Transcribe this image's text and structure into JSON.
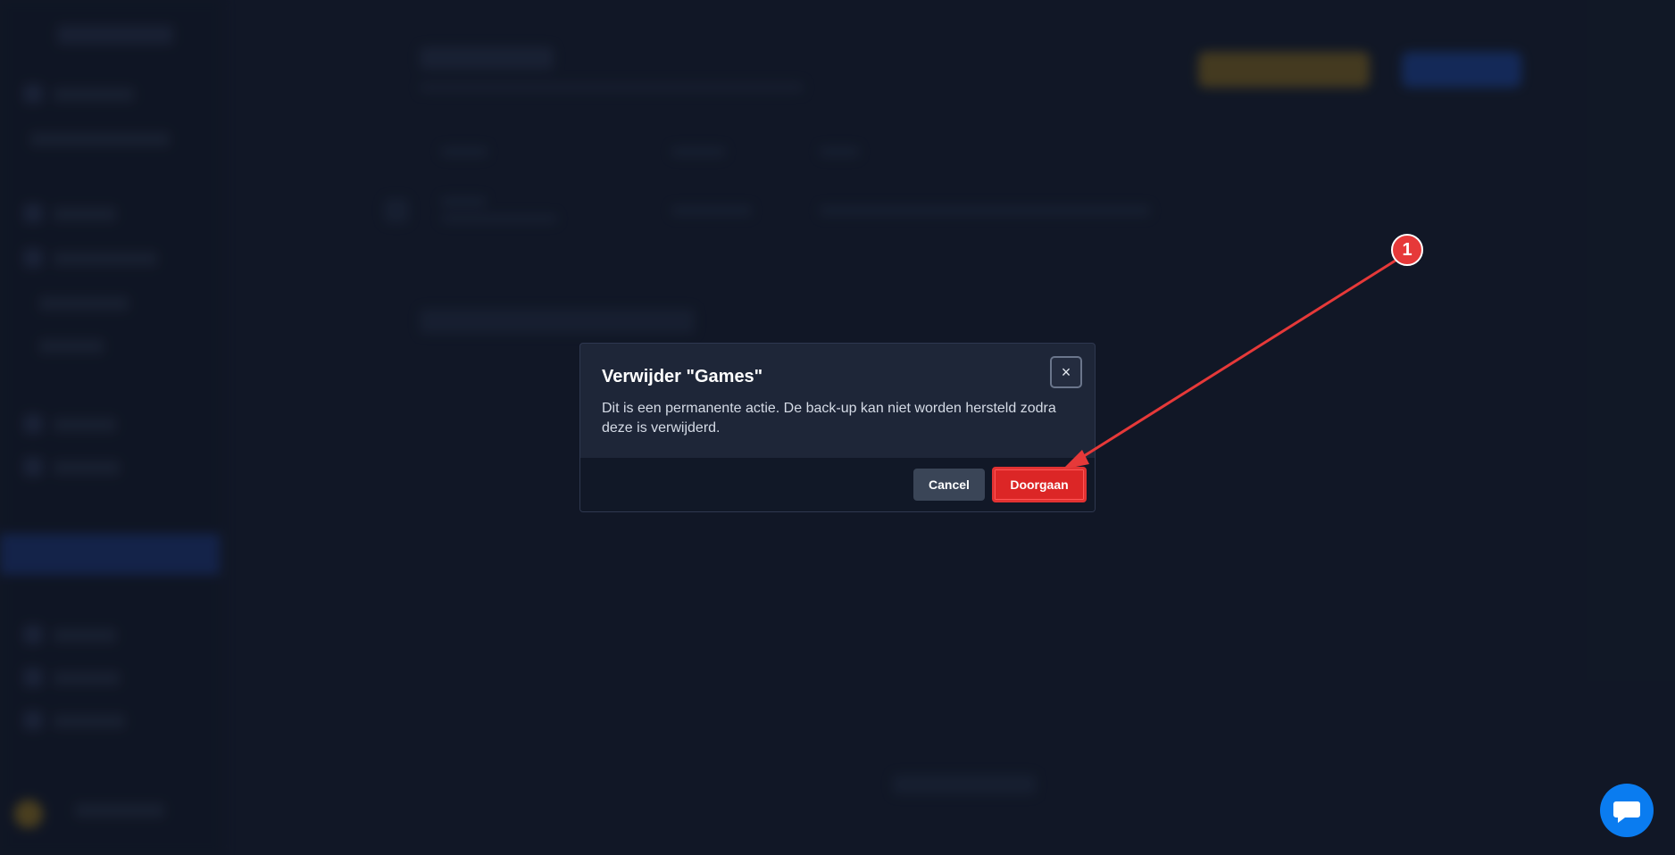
{
  "dialog": {
    "title": "Verwijder \"Games\"",
    "message": "Dit is een permanente actie. De back-up kan niet worden hersteld zodra deze is verwijderd.",
    "close_glyph": "×",
    "cancel_label": "Cancel",
    "confirm_label": "Doorgaan"
  },
  "annotation": {
    "step_number": "1",
    "color": "#e63939"
  },
  "colors": {
    "danger": "#dc2626",
    "background": "#141b2b",
    "chat": "#0a7cf0"
  },
  "icons": {
    "close": "close-icon",
    "chat": "chat-bubble-icon"
  }
}
